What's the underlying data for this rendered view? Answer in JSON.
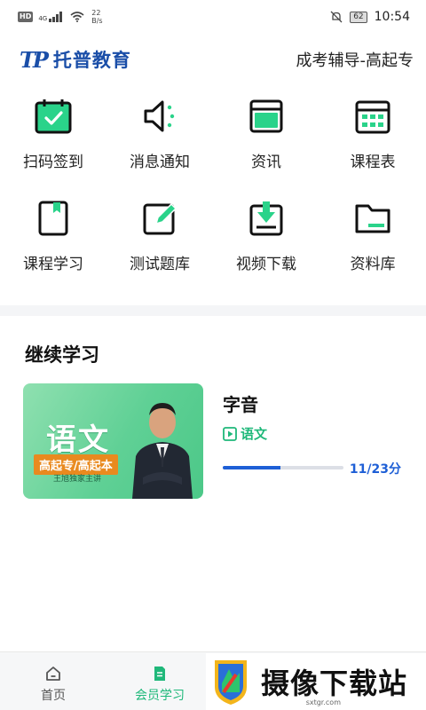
{
  "status_bar": {
    "hd": "HD",
    "net": "4G",
    "speed_value": "22",
    "speed_unit": "B/s",
    "battery": "62",
    "time": "10:54"
  },
  "header": {
    "logo_mark": "TP",
    "logo_text": "托普教育",
    "subtitle": "成考辅导-高起专"
  },
  "grid": {
    "items": [
      {
        "label": "扫码签到",
        "icon": "checkin-calendar-icon"
      },
      {
        "label": "消息通知",
        "icon": "speaker-icon"
      },
      {
        "label": "资讯",
        "icon": "news-window-icon"
      },
      {
        "label": "课程表",
        "icon": "schedule-calendar-icon"
      },
      {
        "label": "课程学习",
        "icon": "book-bookmark-icon"
      },
      {
        "label": "测试题库",
        "icon": "edit-pen-icon"
      },
      {
        "label": "视频下载",
        "icon": "download-icon"
      },
      {
        "label": "资料库",
        "icon": "folder-icon"
      }
    ],
    "accent": "#1fcf7d"
  },
  "continue_section": {
    "title": "继续学习",
    "course": {
      "thumb_title": "语文",
      "thumb_tag": "高起专/高起本",
      "thumb_caption": "王旭独家主讲",
      "title": "字音",
      "subject": "语文",
      "progress": 0.48,
      "progress_text": "11/23分"
    }
  },
  "bottom_nav": {
    "items": [
      {
        "label": "首页",
        "active": false
      },
      {
        "label": "会员学习",
        "active": true
      }
    ]
  },
  "watermark": {
    "text": "摄像下载站",
    "url": "sxtgr.com"
  },
  "colors": {
    "brand_blue": "#1a4ea8",
    "green": "#1fb87a",
    "progress_blue": "#1e5fd6"
  }
}
